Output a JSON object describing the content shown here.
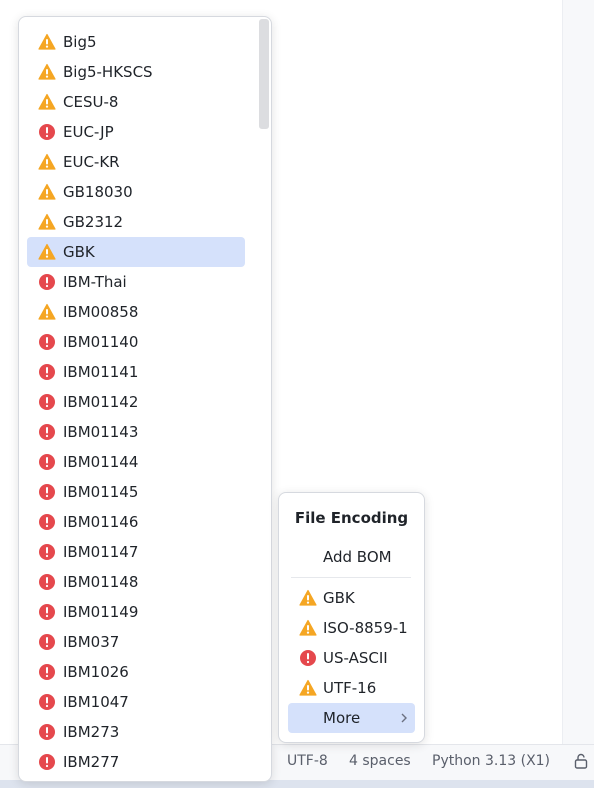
{
  "status_bar": {
    "encoding": "UTF-8",
    "indent": "4 spaces",
    "interpreter": "Python 3.13 (X1)"
  },
  "encoding_list": {
    "items": [
      {
        "label": "Big5",
        "status": "warning",
        "selected": false
      },
      {
        "label": "Big5-HKSCS",
        "status": "warning",
        "selected": false
      },
      {
        "label": "CESU-8",
        "status": "warning",
        "selected": false
      },
      {
        "label": "EUC-JP",
        "status": "error",
        "selected": false
      },
      {
        "label": "EUC-KR",
        "status": "warning",
        "selected": false
      },
      {
        "label": "GB18030",
        "status": "warning",
        "selected": false
      },
      {
        "label": "GB2312",
        "status": "warning",
        "selected": false
      },
      {
        "label": "GBK",
        "status": "warning",
        "selected": true
      },
      {
        "label": "IBM-Thai",
        "status": "error",
        "selected": false
      },
      {
        "label": "IBM00858",
        "status": "warning",
        "selected": false
      },
      {
        "label": "IBM01140",
        "status": "error",
        "selected": false
      },
      {
        "label": "IBM01141",
        "status": "error",
        "selected": false
      },
      {
        "label": "IBM01142",
        "status": "error",
        "selected": false
      },
      {
        "label": "IBM01143",
        "status": "error",
        "selected": false
      },
      {
        "label": "IBM01144",
        "status": "error",
        "selected": false
      },
      {
        "label": "IBM01145",
        "status": "error",
        "selected": false
      },
      {
        "label": "IBM01146",
        "status": "error",
        "selected": false
      },
      {
        "label": "IBM01147",
        "status": "error",
        "selected": false
      },
      {
        "label": "IBM01148",
        "status": "error",
        "selected": false
      },
      {
        "label": "IBM01149",
        "status": "error",
        "selected": false
      },
      {
        "label": "IBM037",
        "status": "error",
        "selected": false
      },
      {
        "label": "IBM1026",
        "status": "error",
        "selected": false
      },
      {
        "label": "IBM1047",
        "status": "error",
        "selected": false
      },
      {
        "label": "IBM273",
        "status": "error",
        "selected": false
      },
      {
        "label": "IBM277",
        "status": "error",
        "selected": false
      }
    ]
  },
  "file_encoding_popup": {
    "title": "File Encoding",
    "add_bom": "Add BOM",
    "items": [
      {
        "label": "GBK",
        "status": "warning"
      },
      {
        "label": "ISO-8859-1",
        "status": "warning"
      },
      {
        "label": "US-ASCII",
        "status": "error"
      },
      {
        "label": "UTF-16",
        "status": "warning"
      }
    ],
    "more_label": "More"
  },
  "colors": {
    "warning": "#f5a623",
    "error": "#e5484d",
    "selection": "#d5e1fb"
  },
  "icons": {
    "warning": "warning-triangle-icon",
    "error": "error-circle-icon",
    "more": "chevron-right-icon",
    "status_lock": "lock-icon"
  }
}
